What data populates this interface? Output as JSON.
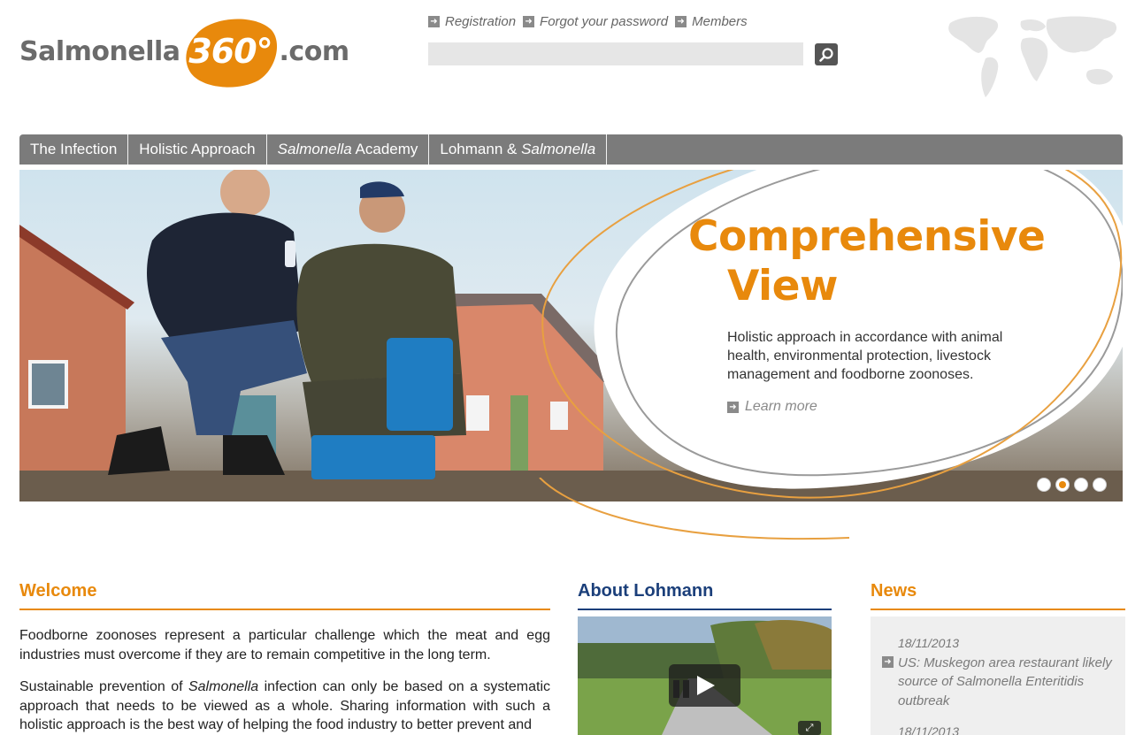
{
  "logo": {
    "left": "Salmonella",
    "badge": "360°",
    "right": ".com"
  },
  "toplinks": [
    {
      "label": "Registration"
    },
    {
      "label": "Forgot your password"
    },
    {
      "label": "Members"
    }
  ],
  "search": {
    "value": "",
    "placeholder": ""
  },
  "nav": {
    "item0": "The Infection",
    "item1": "Holistic Approach",
    "item2_italic": "Salmonella",
    "item2_rest": " Academy",
    "item3_pre": "Lohmann & ",
    "item3_italic": "Salmonella"
  },
  "hero": {
    "title_line1": "Comprehensive",
    "title_line2": "View",
    "text": "Holistic approach in accordance with animal health, environmental protection, livestock management and foodborne zoonoses.",
    "learn_more": "Learn more",
    "slides": 4,
    "active_slide": 2
  },
  "welcome": {
    "title": "Welcome",
    "p1": "Foodborne zoonoses represent a particular challenge which the meat and egg industries must overcome if they are to remain competitive in the long term.",
    "p2_pre": "Sustainable prevention of ",
    "p2_italic": "Salmonella",
    "p2_rest": " infection can only be based on a systematic approach that needs to be viewed as a whole. Sharing information with such a holistic approach is the best way of helping the food industry to better prevent and"
  },
  "about": {
    "title": "About Lohmann"
  },
  "news": {
    "title": "News",
    "items": [
      {
        "date": "18/11/2013",
        "text": "US: Muskegon area restaurant likely source of Salmonella Enteritidis outbreak"
      },
      {
        "date": "18/11/2013",
        "text": ""
      }
    ]
  },
  "colors": {
    "accent": "#e8890c",
    "navy": "#1b3f7a",
    "nav_bg": "#7b7b7b"
  },
  "icons": {
    "search": "magnifier-icon",
    "arrow": "arrow-right-square-icon",
    "play": "play-icon",
    "map": "world-map-icon"
  }
}
